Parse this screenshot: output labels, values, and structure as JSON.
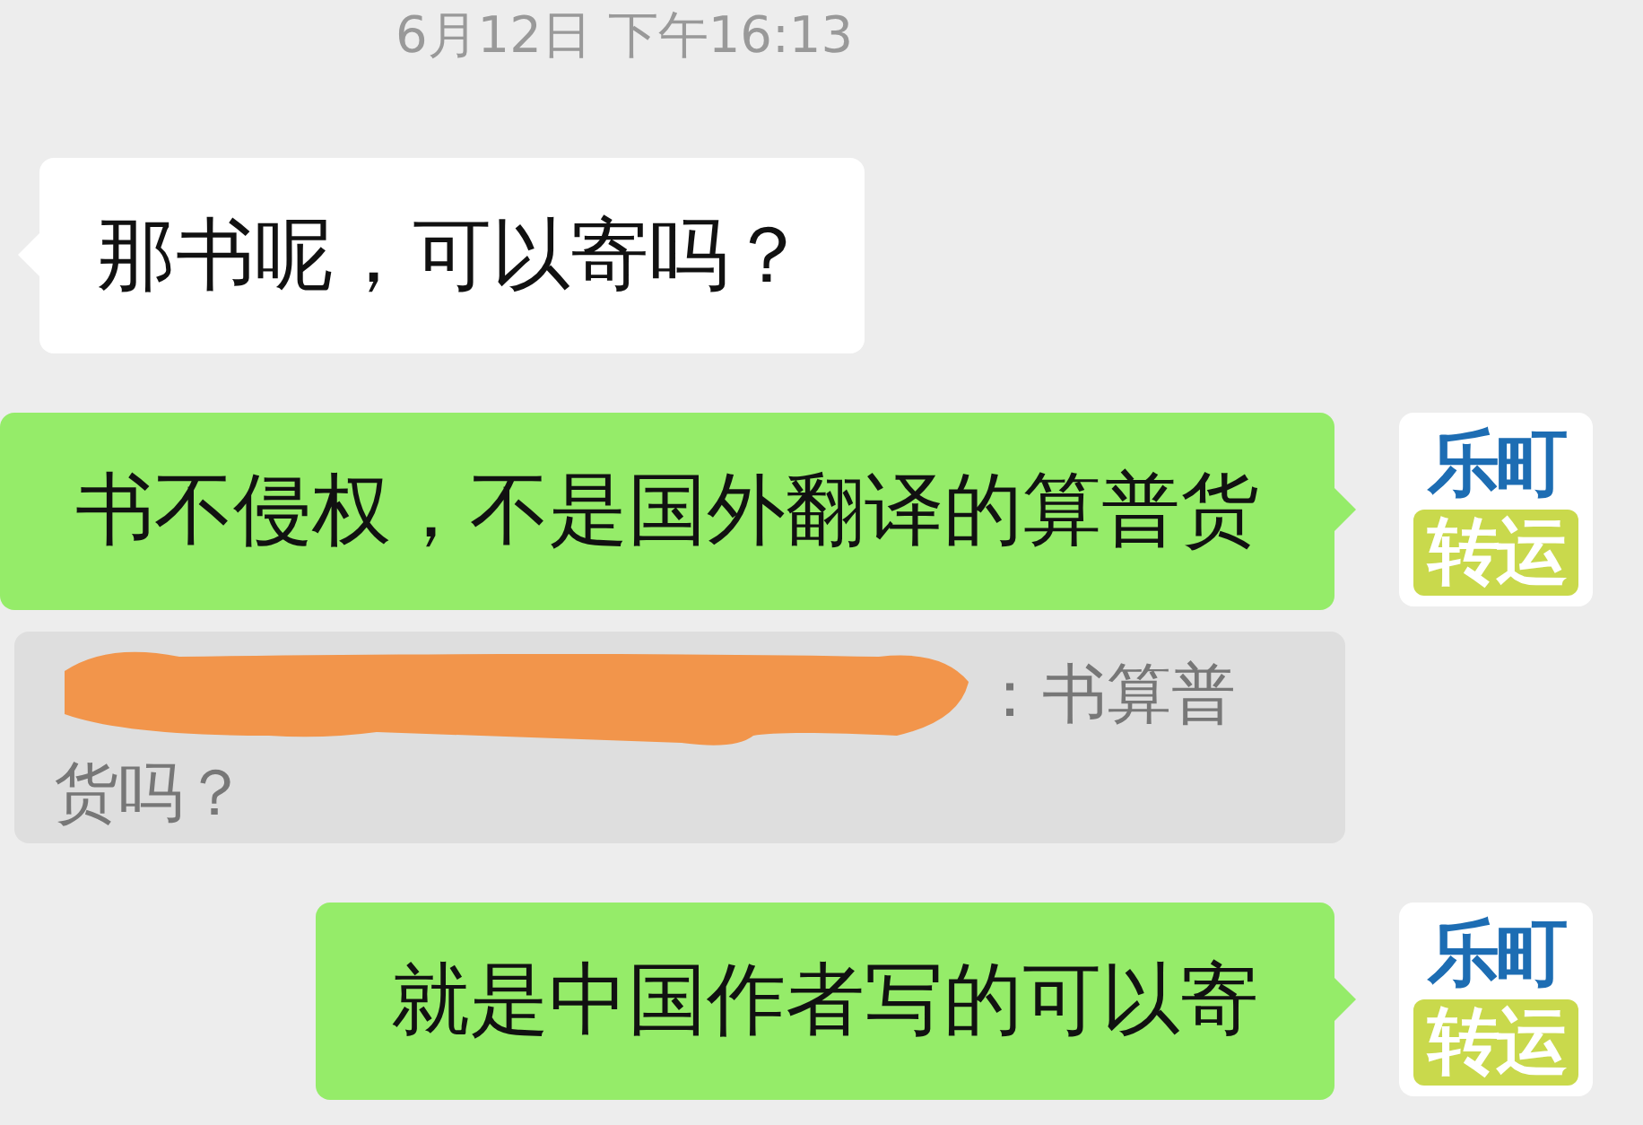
{
  "timestamp": "6月12日 下午16:13",
  "messages": [
    {
      "kind": "incoming",
      "text": "那书呢，可以寄吗？"
    },
    {
      "kind": "outgoing",
      "text": "书不侵权，不是国外翻译的算普货",
      "avatar": {
        "top": "乐町",
        "bottom": "转运"
      }
    },
    {
      "kind": "quote",
      "lines": [
        "：书算普",
        "货吗？"
      ]
    },
    {
      "kind": "outgoing",
      "text": "就是中国作者写的可以寄",
      "avatar": {
        "top": "乐町",
        "bottom": "转运"
      }
    }
  ]
}
